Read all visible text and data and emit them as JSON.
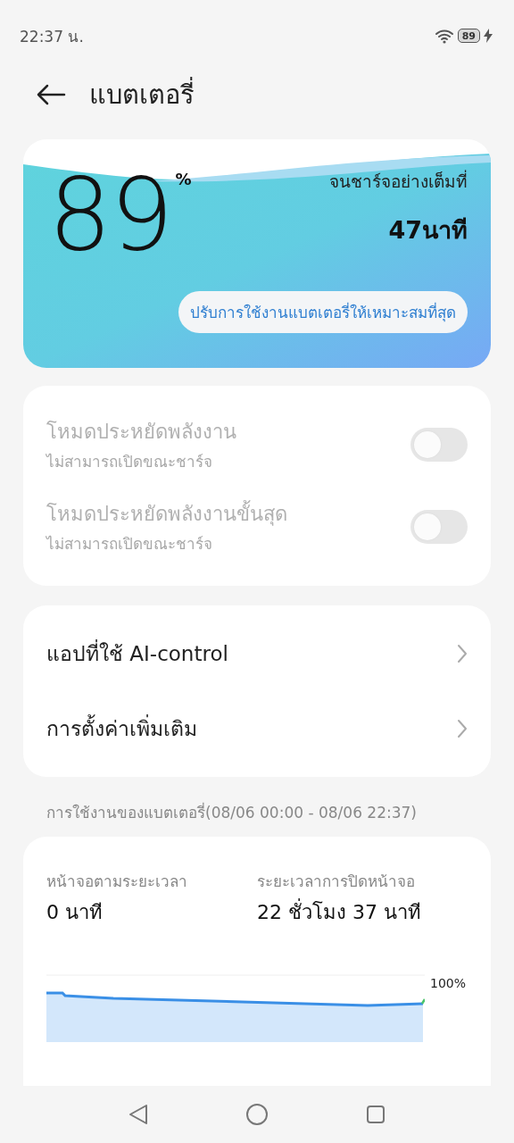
{
  "status_bar": {
    "time": "22:37 น.",
    "battery": "89"
  },
  "header": {
    "title": "แบตเตอรี่"
  },
  "battery_card": {
    "percent": "89",
    "percent_sign": "%",
    "charge_label": "จนชาร์จอย่างเต็มที่",
    "charge_time": "47นาที",
    "optimize_button": "ปรับการใช้งานแบตเตอรี่ให้เหมาะสมที่สุด"
  },
  "power_modes": [
    {
      "title": "โหมดประหยัดพลังงาน",
      "subtitle": "ไม่สามารถเปิดขณะชาร์จ",
      "on": false,
      "disabled": true
    },
    {
      "title": "โหมดประหยัดพลังงานขั้นสุด",
      "subtitle": "ไม่สามารถเปิดขณะชาร์จ",
      "on": false,
      "disabled": true
    }
  ],
  "links": [
    {
      "label": "แอปที่ใช้ AI-control"
    },
    {
      "label": "การตั้งค่าเพิ่มเติม"
    }
  ],
  "usage": {
    "heading": "การใช้งานของแบตเตอรี่(08/06 00:00 - 08/06 22:37)",
    "stats": [
      {
        "label": "หน้าจอตามระยะเวลา",
        "value": "0 นาที"
      },
      {
        "label": "ระยะเวลาการปิดหน้าจอ",
        "value": "22 ชั่วโมง 37 นาที"
      }
    ],
    "chart_axis_label": "100%"
  }
}
